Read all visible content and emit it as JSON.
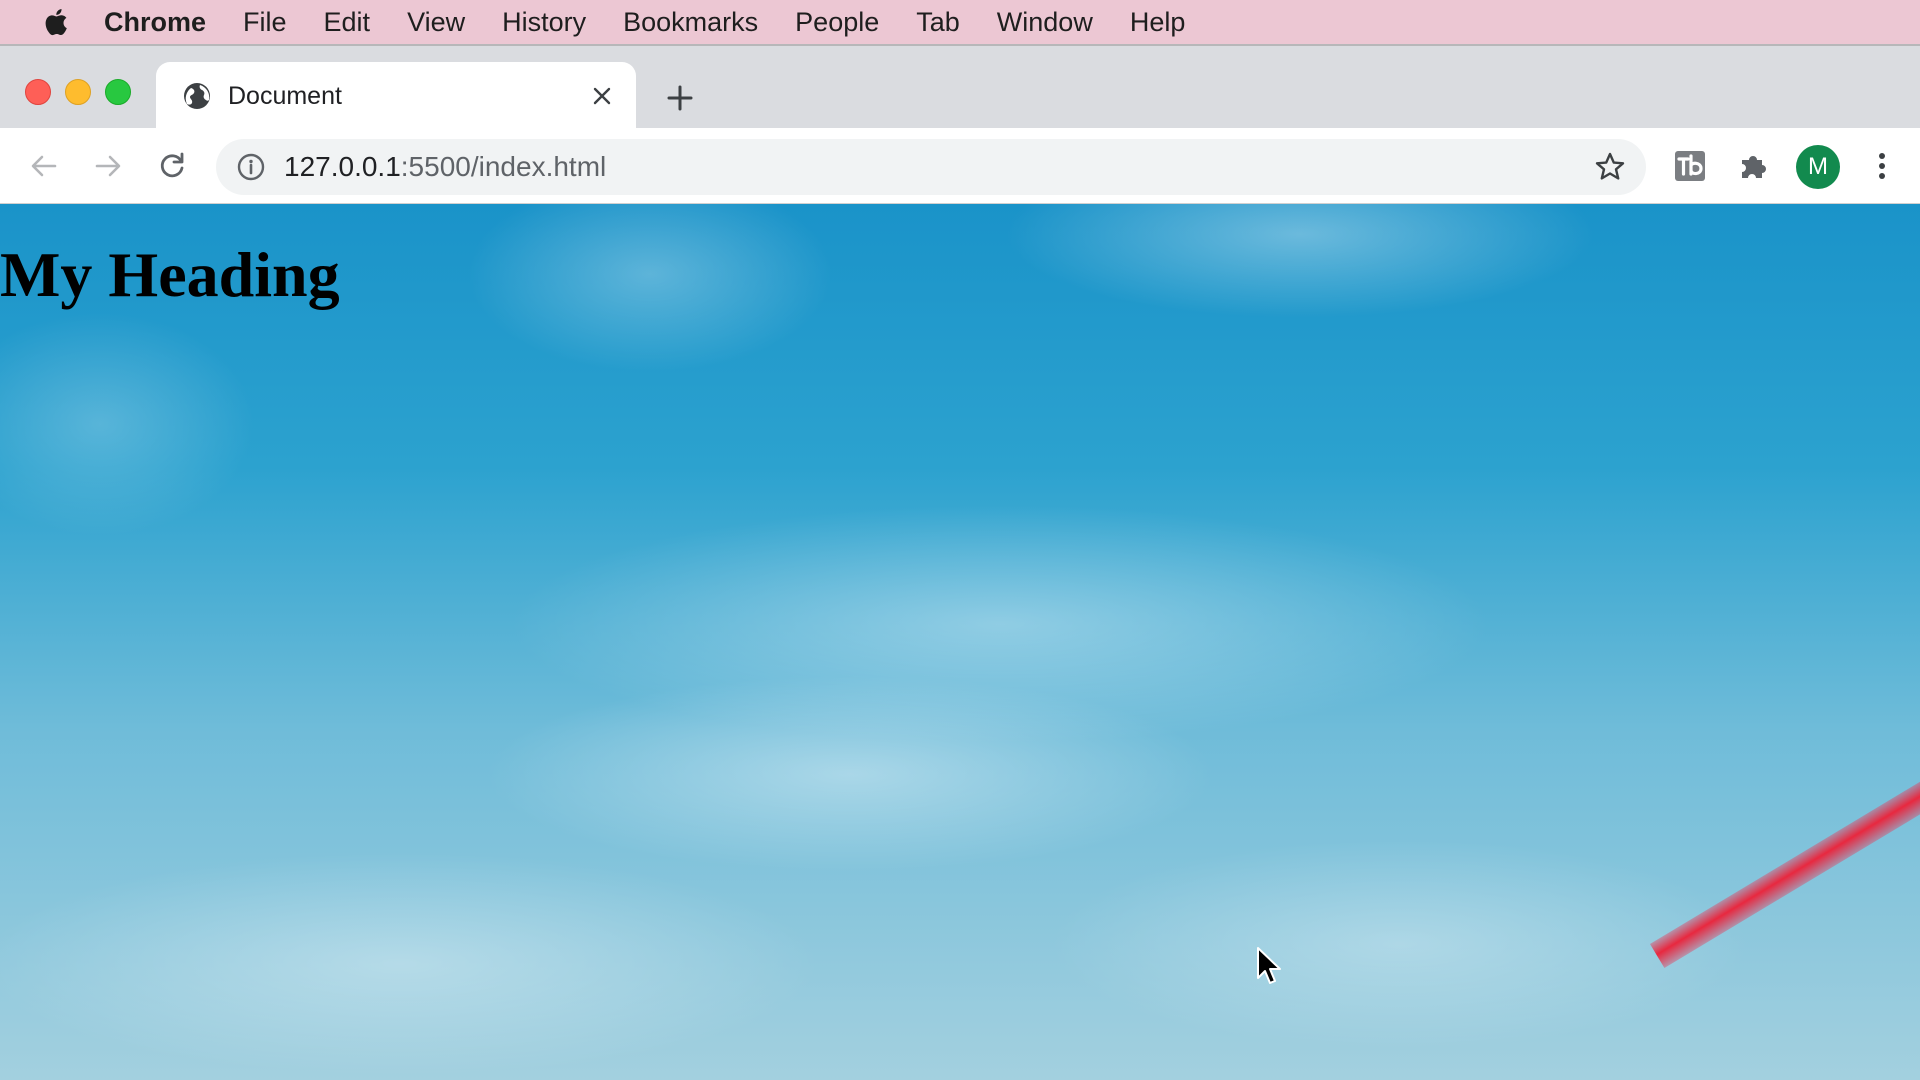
{
  "menubar": {
    "apple_icon": "apple-logo-icon",
    "app_name": "Chrome",
    "items": [
      "File",
      "Edit",
      "View",
      "History",
      "Bookmarks",
      "People",
      "Tab",
      "Window",
      "Help"
    ]
  },
  "window_controls": {
    "close_color": "#fe5f57",
    "minimize_color": "#febc2e",
    "maximize_color": "#28c840"
  },
  "tab": {
    "title": "Document",
    "favicon": "globe-icon",
    "close_icon": "close-icon"
  },
  "new_tab_icon": "plus-icon",
  "toolbar": {
    "back_icon": "arrow-left-icon",
    "forward_icon": "arrow-right-icon",
    "reload_icon": "reload-icon",
    "url_host": "127.0.0.1",
    "url_path": ":5500/index.html",
    "site_info_icon": "info-icon",
    "bookmark_icon": "star-icon",
    "extensions": [
      "tb-extension-icon",
      "puzzle-icon"
    ],
    "profile_initial": "M",
    "profile_color": "#128a4e",
    "menu_icon": "more-vertical-icon"
  },
  "page": {
    "heading": "My Heading",
    "background": "sky-with-clouds-image"
  }
}
